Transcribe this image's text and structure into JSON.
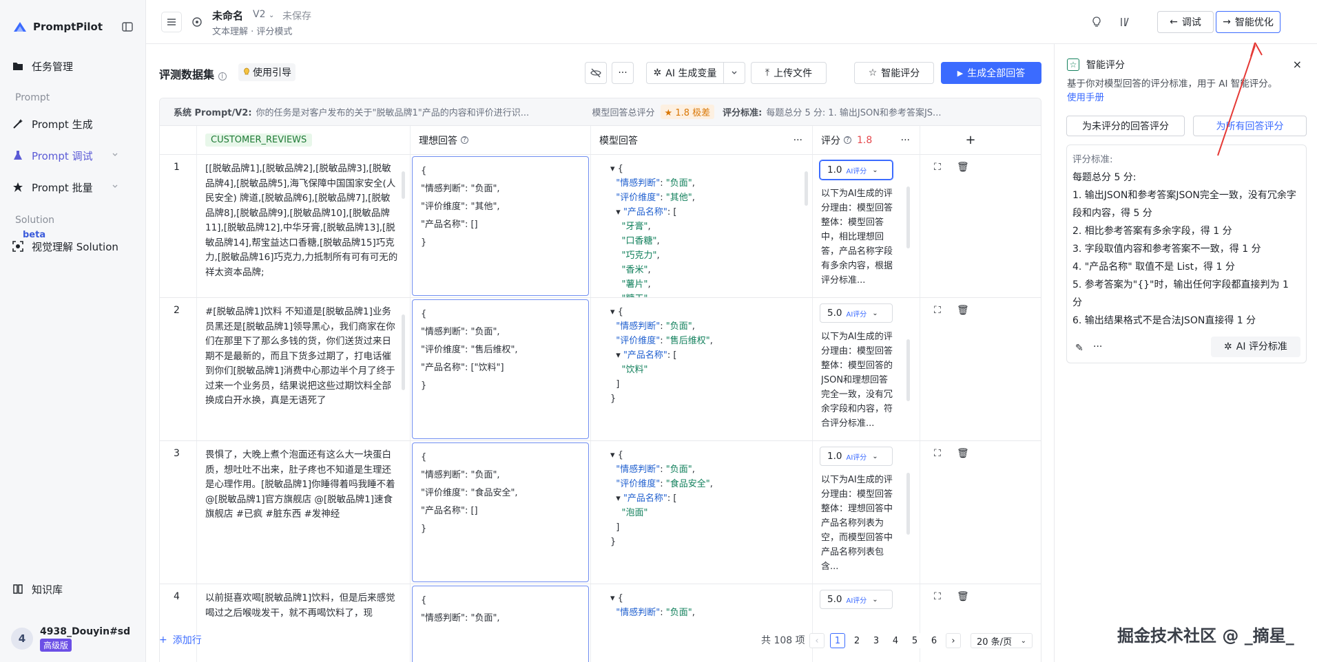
{
  "app": {
    "name": "PromptPilot"
  },
  "sidebar": {
    "items": [
      {
        "label": "任务管理",
        "icon": "folder-icon"
      },
      {
        "section": "Prompt"
      },
      {
        "label": "Prompt 生成",
        "icon": "wand-icon"
      },
      {
        "label": "Prompt 调试",
        "icon": "flask-icon"
      },
      {
        "label": "Prompt 批量",
        "icon": "star-icon"
      },
      {
        "section": "Solution"
      },
      {
        "label": "视觉理解 Solution",
        "icon": "scan-icon",
        "badge": "beta"
      },
      {
        "label": "知识库",
        "icon": "book-icon"
      }
    ],
    "user": {
      "initial": "4",
      "name": "4938_Douyin#sd...",
      "plan": "高级版"
    }
  },
  "topbar": {
    "doc_title": "未命名",
    "version": "V2",
    "status": "未保存",
    "mode": "文本理解 · 评分模式",
    "debug_label": "调试",
    "optimize_label": "智能优化"
  },
  "dataset": {
    "title": "评测数据集",
    "guide_label": "使用引导",
    "ai_var_label": "AI 生成变量",
    "upload_label": "上传文件",
    "smart_score_label": "智能评分",
    "generate_all_label": "生成全部回答",
    "system_prompt_label": "系统 Prompt/V2:",
    "system_prompt_text": "你的任务是对客户发布的关于\"脱敏品牌1\"产品的内容和评价进行识...",
    "total_score_label": "模型回答总评分",
    "total_score_value": "1.8 极差",
    "criteria_label": "评分标准:",
    "criteria_text": "每题总分 5 分:  1. 输出JSON和参考答案JS...",
    "columns": {
      "reviews": "CUSTOMER_REVIEWS",
      "ideal": "理想回答",
      "model": "模型回答",
      "score": "评分",
      "score_value": "1.8"
    },
    "rows": [
      {
        "num": "1",
        "review": "[[脱敏品牌1],[脱敏品牌2],[脱敏品牌3],[脱敏品牌4],[脱敏品牌5],海飞保障中国国家安全(人民安全) 牌道,[脱敏品牌6],[脱敏品牌7],[脱敏品牌8],[脱敏品牌9],[脱敏品牌10],[脱敏品牌11],[脱敏品牌12],中华牙膏,[脱敏品牌13],[脱敏品牌14],帮宝益达口香糖,[脱敏品牌15]巧克力,[脱敏品牌16]巧克力,力抵制所有可有可无的祥太资本品牌;",
        "ideal": [
          "{",
          "\"情感判断\": \"负面\",",
          "\"评价维度\": \"其他\",",
          "\"产品名称\": []",
          "}"
        ],
        "model": {
          "sentiment": "负面",
          "dimension": "其他",
          "products": [
            "牙膏",
            "口香糖",
            "巧克力",
            "香米",
            "薯片",
            "糖干"
          ]
        },
        "score": "1.0",
        "reason": "以下为AI生成的评分理由：模型回答整体：模型回答中，相比理想回答，产品名称字段有多余内容，根据评分标准..."
      },
      {
        "num": "2",
        "review": "#[脱敏品牌1]饮料 不知道是[脱敏品牌1]业务员黑还是[脱敏品牌1]领导黑心，我们商家在你们在那里下了那么多钱的货，你们送货过来日期不是最新的，而且下货多过期了，打电话催到你们[脱敏品牌1]消费中心那边半个月了终于过来一个业务员，结果说把这些过期饮料全部换成白开水换，真是无语死了",
        "ideal": [
          "{",
          "\"情感判断\": \"负面\",",
          "\"评价维度\": \"售后维权\",",
          "\"产品名称\": [\"饮料\"]",
          "}"
        ],
        "model": {
          "sentiment": "负面",
          "dimension": "售后维权",
          "products": [
            "饮料"
          ]
        },
        "score": "5.0",
        "reason": "以下为AI生成的评分理由：模型回答整体：模型回答的JSON和理想回答完全一致，没有冗余字段和内容，符合评分标准..."
      },
      {
        "num": "3",
        "review": "畏惧了，大晚上煮个泡面还有这么大一块蛋白质，想吐吐不出来，肚子疼也不知道是生理还是心理作用。[脱敏品牌1]你睡得着吗我睡不着 @[脱敏品牌1]官方旗舰店 @[脱敏品牌1]速食旗舰店 #已疯 #脏东西 #发神经",
        "ideal": [
          "{",
          "\"情感判断\": \"负面\",",
          "\"评价维度\": \"食品安全\",",
          "\"产品名称\": []",
          "}"
        ],
        "model": {
          "sentiment": "负面",
          "dimension": "食品安全",
          "products": [
            "泡面"
          ]
        },
        "score": "1.0",
        "reason": "以下为AI生成的评分理由：模型回答整体：理想回答中产品名称列表为空，而模型回答中产品名称列表包含..."
      },
      {
        "num": "4",
        "review": "以前挺喜欢喝[脱敏品牌1]饮料，但是后来感觉喝过之后喉咙发干，就不再喝饮料了，现",
        "ideal": [
          "{",
          "\"情感判断\": \"负面\","
        ],
        "model": {
          "sentiment": "负面",
          "dimension": "",
          "products": []
        },
        "score": "5.0",
        "reason": ""
      }
    ],
    "add_row_label": "添加行",
    "pagination": {
      "total": "共 108 项",
      "pages": [
        "1",
        "2",
        "3",
        "4",
        "5",
        "6"
      ],
      "current": "1",
      "page_size": "20 条/页"
    }
  },
  "right_panel": {
    "title": "智能评分",
    "desc": "基于你对模型回答的评分标准，用于 AI 智能评分。",
    "manual_link": "使用手册",
    "btn_unscored": "为未评分的回答评分",
    "btn_all": "为所有回答评分",
    "criteria_title": "评分标准:",
    "criteria_lines": [
      "每题总分 5 分:",
      "1. 输出JSON和参考答案JSON完全一致，没有冗余字段和内容，得 5 分",
      "2. 相比参考答案有多余字段，得 1 分",
      "3. 字段取值内容和参考答案不一致，得 1 分",
      "4. \"产品名称\" 取值不是 List，得 1 分",
      "5. 参考答案为\"{}\"时，输出任何字段都直接判为 1 分",
      "6. 输出结果格式不是合法JSON直接得 1 分"
    ],
    "ai_criteria_label": "AI 评分标准"
  },
  "watermark": "掘金技术社区 @ _摘星_",
  "colors": {
    "accent": "#3b6bff",
    "brand": "#5b5bd6",
    "danger": "#e5484d",
    "score_warn": "#d97706"
  }
}
